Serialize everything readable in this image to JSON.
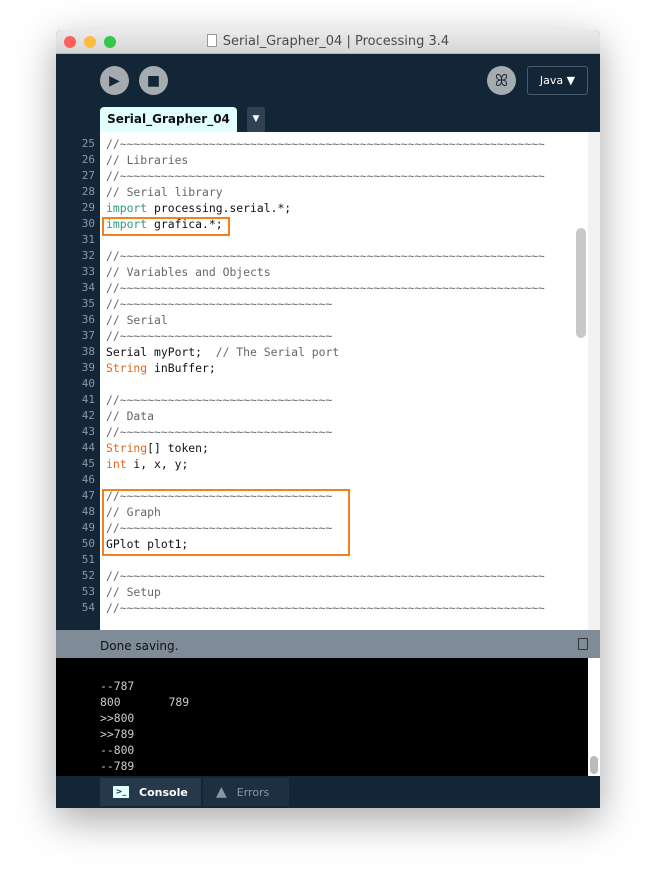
{
  "window": {
    "title": "Serial_Grapher_04 | Processing 3.4"
  },
  "toolbar": {
    "run_label": "▶",
    "stop_label": "■",
    "debug_label": "ꕤ",
    "mode_label": "Java ▼"
  },
  "editor": {
    "tab_label": "Serial_Grapher_04",
    "tab_menu_label": "▼",
    "lines": [
      {
        "n": "25",
        "t": "//~~~~~~~~~~~~~~~~~~~~~~~~~~~~~~~~~~~~~~~~~~~~~~~~~~~~~~~~~~~~~~",
        "c": "cm"
      },
      {
        "n": "26",
        "t": "// Libraries",
        "c": "cm"
      },
      {
        "n": "27",
        "t": "//~~~~~~~~~~~~~~~~~~~~~~~~~~~~~~~~~~~~~~~~~~~~~~~~~~~~~~~~~~~~~~",
        "c": "cm"
      },
      {
        "n": "28",
        "t": "// Serial library",
        "c": "cm"
      },
      {
        "n": "29",
        "k": "import",
        "t": " processing.serial.*;",
        "c": "kw"
      },
      {
        "n": "30",
        "k": "import",
        "t": " grafica.*;",
        "c": "kw"
      },
      {
        "n": "31",
        "t": ""
      },
      {
        "n": "32",
        "t": "//~~~~~~~~~~~~~~~~~~~~~~~~~~~~~~~~~~~~~~~~~~~~~~~~~~~~~~~~~~~~~~",
        "c": "cm"
      },
      {
        "n": "33",
        "t": "// Variables and Objects",
        "c": "cm"
      },
      {
        "n": "34",
        "t": "//~~~~~~~~~~~~~~~~~~~~~~~~~~~~~~~~~~~~~~~~~~~~~~~~~~~~~~~~~~~~~~",
        "c": "cm"
      },
      {
        "n": "35",
        "t": "//~~~~~~~~~~~~~~~~~~~~~~~~~~~~~~~",
        "c": "cm"
      },
      {
        "n": "36",
        "t": "// Serial",
        "c": "cm"
      },
      {
        "n": "37",
        "t": "//~~~~~~~~~~~~~~~~~~~~~~~~~~~~~~~",
        "c": "cm"
      },
      {
        "n": "38",
        "t": "Serial myPort;  ",
        "x": "// The Serial port"
      },
      {
        "n": "39",
        "k": "String",
        "t": " inBuffer;",
        "c": "ty"
      },
      {
        "n": "40",
        "t": ""
      },
      {
        "n": "41",
        "t": "//~~~~~~~~~~~~~~~~~~~~~~~~~~~~~~~",
        "c": "cm"
      },
      {
        "n": "42",
        "t": "// Data",
        "c": "cm"
      },
      {
        "n": "43",
        "t": "//~~~~~~~~~~~~~~~~~~~~~~~~~~~~~~~",
        "c": "cm"
      },
      {
        "n": "44",
        "k": "String",
        "t": "[] token;",
        "c": "ty"
      },
      {
        "n": "45",
        "k": "int",
        "t": " i, x, y;",
        "c": "ty"
      },
      {
        "n": "46",
        "t": ""
      },
      {
        "n": "47",
        "t": "//~~~~~~~~~~~~~~~~~~~~~~~~~~~~~~~",
        "c": "cm"
      },
      {
        "n": "48",
        "t": "// Graph",
        "c": "cm"
      },
      {
        "n": "49",
        "t": "//~~~~~~~~~~~~~~~~~~~~~~~~~~~~~~~",
        "c": "cm"
      },
      {
        "n": "50",
        "t": "GPlot plot1;"
      },
      {
        "n": "51",
        "t": ""
      },
      {
        "n": "52",
        "t": "//~~~~~~~~~~~~~~~~~~~~~~~~~~~~~~~~~~~~~~~~~~~~~~~~~~~~~~~~~~~~~~",
        "c": "cm"
      },
      {
        "n": "53",
        "t": "// Setup",
        "c": "cm"
      },
      {
        "n": "54",
        "t": "//~~~~~~~~~~~~~~~~~~~~~~~~~~~~~~~~~~~~~~~~~~~~~~~~~~~~~~~~~~~~~~",
        "c": "cm"
      }
    ]
  },
  "status": {
    "message": "Done saving."
  },
  "console": {
    "lines": [
      "--787",
      "800       789",
      ">>800",
      ">>789",
      "--800",
      "--789"
    ]
  },
  "bottom_tabs": {
    "console": "Console",
    "errors": "Errors"
  },
  "colors": {
    "highlight": "#f5801e",
    "keyword": "#33997e",
    "type": "#e2661a",
    "background": "#132638"
  }
}
